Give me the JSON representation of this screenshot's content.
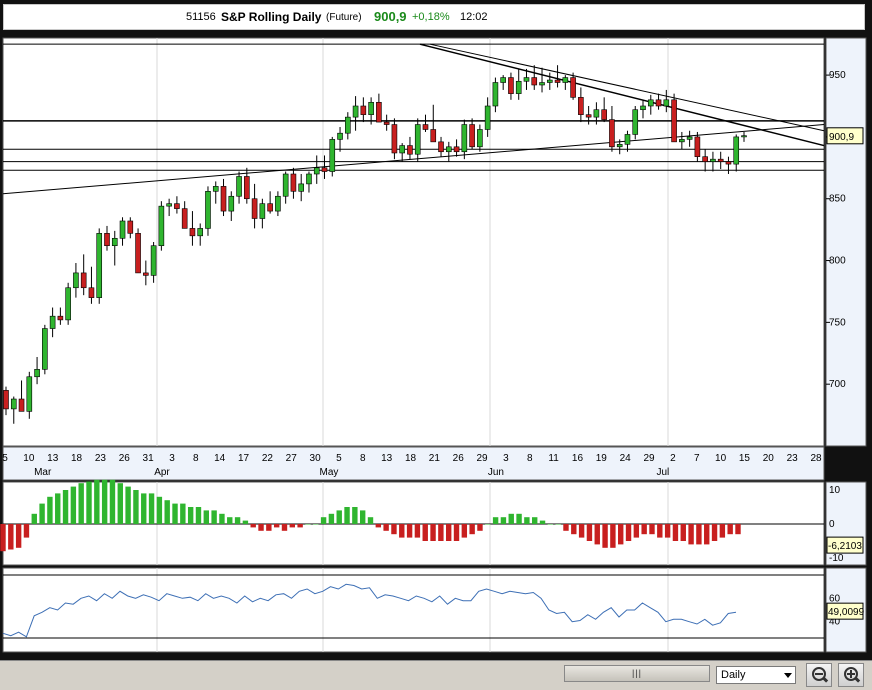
{
  "header": {
    "code": "51156",
    "name": "S&P Rolling Daily",
    "type": "(Future)",
    "price": "900,9",
    "change": "+0,18%",
    "time": "12:02"
  },
  "colors": {
    "up": "#2fb52f",
    "down": "#c81f1f",
    "panel_bg": "#ffffff",
    "axis_bg": "#eef3fb",
    "rsi_line": "#3d6fb5",
    "last_price_bg": "#ffffcc"
  },
  "chart_data": [
    {
      "type": "candlestick",
      "x_day_labels": [
        "5",
        "10",
        "13",
        "18",
        "23",
        "26",
        "31",
        "3",
        "8",
        "14",
        "17",
        "22",
        "27",
        "30",
        "5",
        "8",
        "13",
        "18",
        "21",
        "26",
        "29",
        "3",
        "8",
        "11",
        "16",
        "19",
        "24",
        "29",
        "2",
        "7",
        "10",
        "15",
        "20",
        "23",
        "28"
      ],
      "x_month_labels": [
        "Mar",
        "Apr",
        "May",
        "Jun",
        "Jul"
      ],
      "y_ticks": [
        "950",
        "900",
        "850",
        "800",
        "750",
        "700"
      ],
      "ylim": [
        650,
        980
      ],
      "last_value_label": "900,9",
      "candles": [
        {
          "o": 695,
          "h": 698,
          "l": 675,
          "c": 680
        },
        {
          "o": 680,
          "h": 690,
          "l": 668,
          "c": 688
        },
        {
          "o": 688,
          "h": 703,
          "l": 682,
          "c": 678
        },
        {
          "o": 678,
          "h": 710,
          "l": 672,
          "c": 706
        },
        {
          "o": 706,
          "h": 722,
          "l": 700,
          "c": 712
        },
        {
          "o": 712,
          "h": 748,
          "l": 708,
          "c": 745
        },
        {
          "o": 745,
          "h": 762,
          "l": 738,
          "c": 755
        },
        {
          "o": 755,
          "h": 762,
          "l": 748,
          "c": 752
        },
        {
          "o": 752,
          "h": 782,
          "l": 748,
          "c": 778
        },
        {
          "o": 778,
          "h": 798,
          "l": 770,
          "c": 790
        },
        {
          "o": 790,
          "h": 805,
          "l": 772,
          "c": 778
        },
        {
          "o": 778,
          "h": 795,
          "l": 765,
          "c": 770
        },
        {
          "o": 770,
          "h": 826,
          "l": 765,
          "c": 822
        },
        {
          "o": 822,
          "h": 828,
          "l": 808,
          "c": 812
        },
        {
          "o": 812,
          "h": 824,
          "l": 796,
          "c": 818
        },
        {
          "o": 818,
          "h": 835,
          "l": 812,
          "c": 832
        },
        {
          "o": 832,
          "h": 835,
          "l": 818,
          "c": 822
        },
        {
          "o": 822,
          "h": 826,
          "l": 790,
          "c": 790
        },
        {
          "o": 790,
          "h": 800,
          "l": 780,
          "c": 788
        },
        {
          "o": 788,
          "h": 815,
          "l": 782,
          "c": 812
        },
        {
          "o": 812,
          "h": 848,
          "l": 808,
          "c": 844
        },
        {
          "o": 844,
          "h": 850,
          "l": 836,
          "c": 846
        },
        {
          "o": 846,
          "h": 852,
          "l": 838,
          "c": 842
        },
        {
          "o": 842,
          "h": 848,
          "l": 826,
          "c": 826
        },
        {
          "o": 826,
          "h": 840,
          "l": 812,
          "c": 820
        },
        {
          "o": 820,
          "h": 830,
          "l": 812,
          "c": 826
        },
        {
          "o": 826,
          "h": 860,
          "l": 820,
          "c": 856
        },
        {
          "o": 856,
          "h": 864,
          "l": 846,
          "c": 860
        },
        {
          "o": 860,
          "h": 866,
          "l": 836,
          "c": 840
        },
        {
          "o": 840,
          "h": 856,
          "l": 832,
          "c": 852
        },
        {
          "o": 852,
          "h": 872,
          "l": 846,
          "c": 868
        },
        {
          "o": 868,
          "h": 875,
          "l": 846,
          "c": 850
        },
        {
          "o": 850,
          "h": 862,
          "l": 826,
          "c": 834
        },
        {
          "o": 834,
          "h": 850,
          "l": 826,
          "c": 846
        },
        {
          "o": 846,
          "h": 856,
          "l": 838,
          "c": 840
        },
        {
          "o": 840,
          "h": 856,
          "l": 836,
          "c": 852
        },
        {
          "o": 852,
          "h": 872,
          "l": 846,
          "c": 870
        },
        {
          "o": 870,
          "h": 875,
          "l": 850,
          "c": 856
        },
        {
          "o": 856,
          "h": 870,
          "l": 848,
          "c": 862
        },
        {
          "o": 862,
          "h": 872,
          "l": 855,
          "c": 870
        },
        {
          "o": 870,
          "h": 885,
          "l": 862,
          "c": 875
        },
        {
          "o": 875,
          "h": 885,
          "l": 866,
          "c": 872
        },
        {
          "o": 872,
          "h": 900,
          "l": 868,
          "c": 898
        },
        {
          "o": 898,
          "h": 908,
          "l": 888,
          "c": 903
        },
        {
          "o": 903,
          "h": 920,
          "l": 898,
          "c": 916
        },
        {
          "o": 916,
          "h": 933,
          "l": 905,
          "c": 925
        },
        {
          "o": 925,
          "h": 932,
          "l": 912,
          "c": 918
        },
        {
          "o": 918,
          "h": 932,
          "l": 910,
          "c": 928
        },
        {
          "o": 928,
          "h": 935,
          "l": 912,
          "c": 912
        },
        {
          "o": 912,
          "h": 918,
          "l": 905,
          "c": 910
        },
        {
          "o": 910,
          "h": 915,
          "l": 882,
          "c": 887
        },
        {
          "o": 887,
          "h": 895,
          "l": 880,
          "c": 893
        },
        {
          "o": 893,
          "h": 900,
          "l": 882,
          "c": 886
        },
        {
          "o": 886,
          "h": 915,
          "l": 880,
          "c": 910
        },
        {
          "o": 910,
          "h": 918,
          "l": 904,
          "c": 906
        },
        {
          "o": 906,
          "h": 926,
          "l": 898,
          "c": 896
        },
        {
          "o": 896,
          "h": 900,
          "l": 884,
          "c": 888
        },
        {
          "o": 888,
          "h": 896,
          "l": 880,
          "c": 892
        },
        {
          "o": 892,
          "h": 898,
          "l": 884,
          "c": 888
        },
        {
          "o": 888,
          "h": 914,
          "l": 882,
          "c": 910
        },
        {
          "o": 910,
          "h": 915,
          "l": 890,
          "c": 892
        },
        {
          "o": 892,
          "h": 910,
          "l": 888,
          "c": 906
        },
        {
          "o": 906,
          "h": 932,
          "l": 900,
          "c": 925
        },
        {
          "o": 925,
          "h": 948,
          "l": 920,
          "c": 944
        },
        {
          "o": 944,
          "h": 950,
          "l": 938,
          "c": 948
        },
        {
          "o": 948,
          "h": 952,
          "l": 930,
          "c": 935
        },
        {
          "o": 935,
          "h": 955,
          "l": 930,
          "c": 945
        },
        {
          "o": 945,
          "h": 955,
          "l": 938,
          "c": 948
        },
        {
          "o": 948,
          "h": 958,
          "l": 938,
          "c": 942
        },
        {
          "o": 942,
          "h": 956,
          "l": 936,
          "c": 944
        },
        {
          "o": 944,
          "h": 952,
          "l": 938,
          "c": 946
        },
        {
          "o": 946,
          "h": 958,
          "l": 940,
          "c": 944
        },
        {
          "o": 944,
          "h": 950,
          "l": 938,
          "c": 948
        },
        {
          "o": 948,
          "h": 952,
          "l": 930,
          "c": 932
        },
        {
          "o": 932,
          "h": 940,
          "l": 912,
          "c": 918
        },
        {
          "o": 918,
          "h": 925,
          "l": 910,
          "c": 916
        },
        {
          "o": 916,
          "h": 928,
          "l": 910,
          "c": 922
        },
        {
          "o": 922,
          "h": 932,
          "l": 912,
          "c": 914
        },
        {
          "o": 914,
          "h": 925,
          "l": 888,
          "c": 892
        },
        {
          "o": 892,
          "h": 898,
          "l": 886,
          "c": 894
        },
        {
          "o": 894,
          "h": 905,
          "l": 888,
          "c": 902
        },
        {
          "o": 902,
          "h": 925,
          "l": 898,
          "c": 922
        },
        {
          "o": 922,
          "h": 930,
          "l": 915,
          "c": 925
        },
        {
          "o": 925,
          "h": 934,
          "l": 918,
          "c": 930
        },
        {
          "o": 930,
          "h": 935,
          "l": 922,
          "c": 925
        },
        {
          "o": 925,
          "h": 938,
          "l": 920,
          "c": 930
        },
        {
          "o": 930,
          "h": 935,
          "l": 896,
          "c": 896
        },
        {
          "o": 896,
          "h": 904,
          "l": 890,
          "c": 898
        },
        {
          "o": 898,
          "h": 905,
          "l": 892,
          "c": 900
        },
        {
          "o": 900,
          "h": 904,
          "l": 880,
          "c": 884
        },
        {
          "o": 884,
          "h": 890,
          "l": 872,
          "c": 880
        },
        {
          "o": 880,
          "h": 888,
          "l": 872,
          "c": 882
        },
        {
          "o": 882,
          "h": 888,
          "l": 874,
          "c": 880
        },
        {
          "o": 880,
          "h": 884,
          "l": 870,
          "c": 878
        },
        {
          "o": 878,
          "h": 902,
          "l": 872,
          "c": 900
        },
        {
          "o": 900,
          "h": 904,
          "l": 896,
          "c": 901
        }
      ]
    },
    {
      "type": "bar",
      "ylim": [
        -10,
        10
      ],
      "y_ticks": [
        "10",
        "0",
        "-10"
      ],
      "last_value_label": "-6,2103",
      "values": [
        -8,
        -7.5,
        -7,
        -4,
        3,
        6,
        8,
        9,
        10,
        11,
        12,
        12.5,
        13,
        13,
        13,
        12,
        11,
        10,
        9,
        9,
        8,
        7,
        6,
        6,
        5,
        5,
        4,
        4,
        3,
        2,
        2,
        1,
        -1,
        -2,
        -2,
        -1,
        -2,
        -1,
        -1,
        0,
        0,
        2,
        3,
        4,
        5,
        5,
        4,
        2,
        -1,
        -2,
        -3,
        -4,
        -4,
        -4,
        -5,
        -5,
        -5,
        -5,
        -5,
        -4,
        -3,
        -2,
        0,
        2,
        2,
        3,
        3,
        2,
        2,
        1,
        0,
        0,
        -2,
        -3,
        -4,
        -5,
        -6,
        -7,
        -7,
        -6,
        -5,
        -4,
        -3,
        -3,
        -4,
        -4,
        -5,
        -5,
        -6,
        -6,
        -6,
        -5,
        -4,
        -3,
        -3
      ]
    },
    {
      "type": "line",
      "ylim": [
        20,
        80
      ],
      "y_ticks": [
        "60",
        "40"
      ],
      "last_value_label": "49,0099",
      "values": [
        30,
        28,
        31,
        27,
        45,
        48,
        52,
        50,
        56,
        55,
        60,
        62,
        58,
        64,
        60,
        66,
        62,
        60,
        63,
        61,
        58,
        64,
        62,
        60,
        61,
        58,
        64,
        60,
        62,
        60,
        56,
        62,
        57,
        60,
        58,
        63,
        64,
        60,
        66,
        68,
        64,
        66,
        70,
        68,
        72,
        71,
        68,
        69,
        60,
        63,
        62,
        60,
        58,
        62,
        60,
        57,
        62,
        55,
        60,
        58,
        58,
        66,
        68,
        66,
        64,
        66,
        65,
        64,
        65,
        60,
        50,
        47,
        48,
        40,
        41,
        46,
        42,
        48,
        52,
        44,
        50,
        50,
        56,
        52,
        48,
        40,
        42,
        42,
        40,
        38,
        42,
        37,
        39,
        47,
        48
      ]
    }
  ],
  "toolbar": {
    "scroll_grip": "|||",
    "period": "Daily"
  }
}
